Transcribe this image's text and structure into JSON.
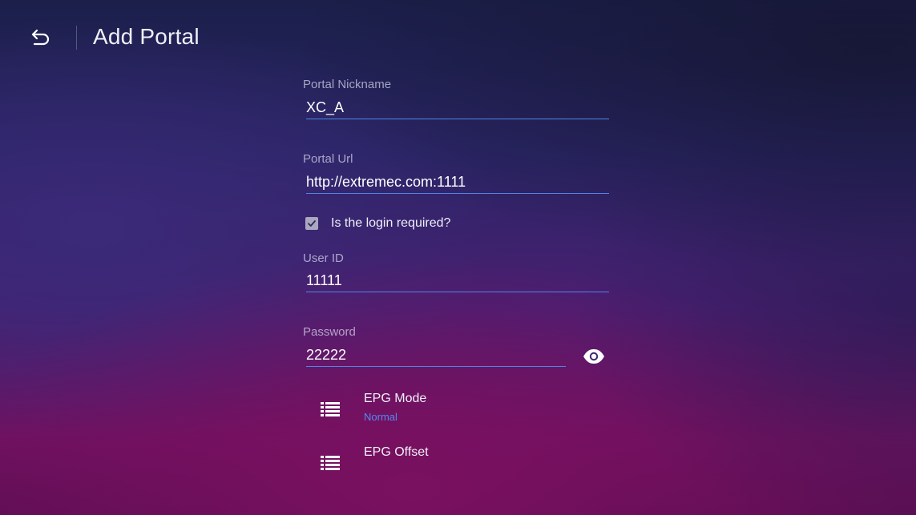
{
  "header": {
    "title": "Add Portal",
    "back_icon": "back-arrow-icon"
  },
  "form": {
    "nickname": {
      "label": "Portal Nickname",
      "value": "XC_A"
    },
    "url": {
      "label": "Portal Url",
      "value": "http://extremec.com:1111"
    },
    "login_required": {
      "label": "Is the login required?",
      "checked": true
    },
    "user_id": {
      "label": "User ID",
      "value": "11111"
    },
    "password": {
      "label": "Password",
      "value": "22222",
      "toggle_icon": "eye-icon"
    }
  },
  "settings": [
    {
      "title": "EPG Mode",
      "value": "Normal",
      "icon": "list-icon"
    },
    {
      "title": "EPG Offset",
      "value": "",
      "icon": "list-icon"
    }
  ],
  "colors": {
    "accent": "#4f86e6",
    "value_text": "#4c8cf5"
  }
}
